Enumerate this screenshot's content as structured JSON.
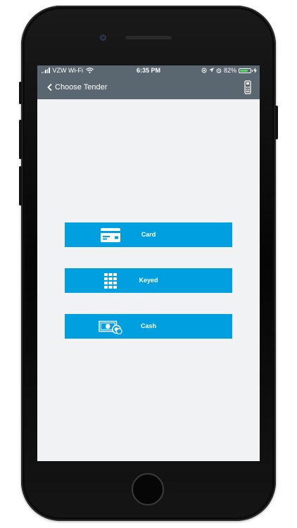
{
  "status_bar": {
    "carrier": "VZW Wi-Fi",
    "time": "6:35 PM",
    "battery_percent": "82%",
    "battery_level": 0.82,
    "icons": [
      "signal-icon",
      "wifi-icon",
      "orientation-lock-icon",
      "location-icon",
      "alarm-icon",
      "battery-icon",
      "charging-icon"
    ]
  },
  "nav": {
    "back_label": "Choose Tender",
    "back_icon": "chevron-left-icon",
    "right_icon": "card-reader-icon"
  },
  "tenders": [
    {
      "label": "Card",
      "icon": "credit-card-icon"
    },
    {
      "label": "Keyed",
      "icon": "keypad-icon"
    },
    {
      "label": "Cash",
      "icon": "cash-icon"
    }
  ],
  "colors": {
    "bar": "#5b6770",
    "accent": "#009fdf",
    "background": "#f0f2f4"
  }
}
